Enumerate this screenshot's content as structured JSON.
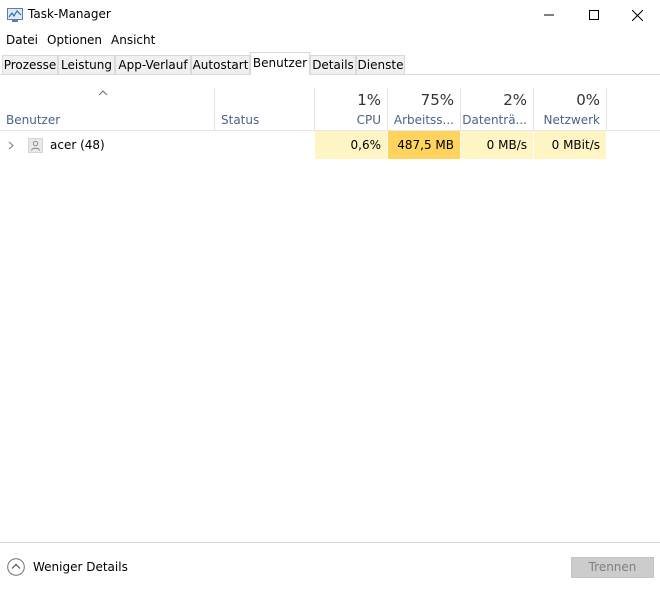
{
  "window": {
    "title": "Task-Manager",
    "controls": [
      "minimize",
      "maximize",
      "close"
    ]
  },
  "menu": {
    "items": [
      "Datei",
      "Optionen",
      "Ansicht"
    ]
  },
  "tabs": {
    "items": [
      "Prozesse",
      "Leistung",
      "App-Verlauf",
      "Autostart",
      "Benutzer",
      "Details",
      "Dienste"
    ],
    "active": "Benutzer"
  },
  "columns": {
    "user": {
      "label": "Benutzer"
    },
    "status": {
      "label": "Status"
    },
    "cpu": {
      "percent": "1%",
      "label": "CPU"
    },
    "memory": {
      "percent": "75%",
      "label": "Arbeitss..."
    },
    "disk": {
      "percent": "2%",
      "label": "Datenträ..."
    },
    "network": {
      "percent": "0%",
      "label": "Netzwerk"
    }
  },
  "rows": [
    {
      "name": "acer (48)",
      "status": "",
      "cpu": "0,6%",
      "memory": "487,5 MB",
      "disk": "0 MB/s",
      "network": "0 MBit/s"
    }
  ],
  "footer": {
    "less_details": "Weniger Details",
    "disconnect": "Trennen"
  },
  "colors": {
    "heat_light": "#fff4c4",
    "heat_medium": "#f9ec9f",
    "heat_strong": "#ffd35d",
    "header_text": "#4a6385"
  }
}
